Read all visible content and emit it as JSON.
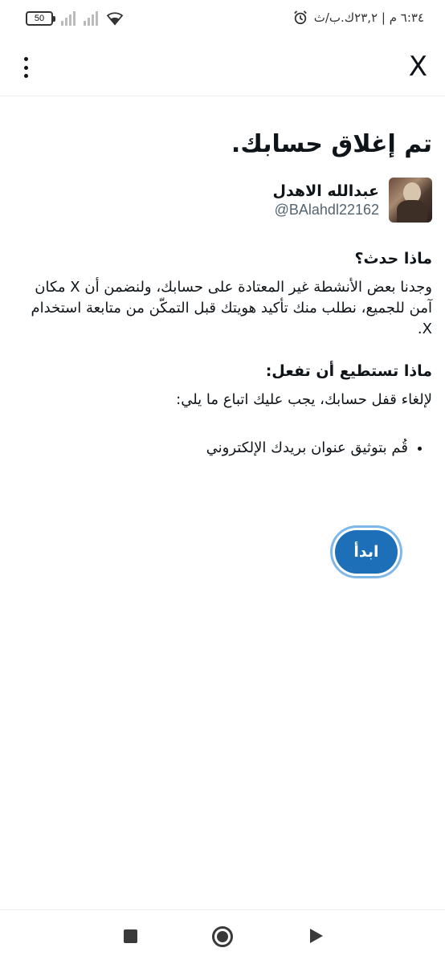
{
  "status_bar": {
    "battery": "50",
    "time": "٦:٣٤ م | ٢٣,٢ك.ب/ث"
  },
  "app_bar": {
    "close_label": "X",
    "menu_icon": "more-vertical-icon"
  },
  "page": {
    "title": "تم إغلاق حسابك.",
    "account_name": "عبدالله الاهدل",
    "account_handle": "@BAlahdl22162",
    "what_happened_heading": "ماذا حدث؟",
    "what_happened_text": "وجدنا بعض الأنشطة غير المعتادة على حسابك، ولنضمن أن X مكان آمن للجميع، نطلب منك تأكيد هويتك قبل التمكّن من متابعة استخدام X.",
    "what_to_do_heading": "ماذا تستطيع أن تفعل:",
    "what_to_do_text": "لإلغاء قفل حسابك، يجب عليك اتباع ما يلي:",
    "steps": [
      "قُم بتوثيق عنوان بريدك الإلكتروني"
    ],
    "start_button": "ابدأ"
  },
  "colors": {
    "button_bg": "#1d6fb8",
    "handle_text": "#536471"
  }
}
